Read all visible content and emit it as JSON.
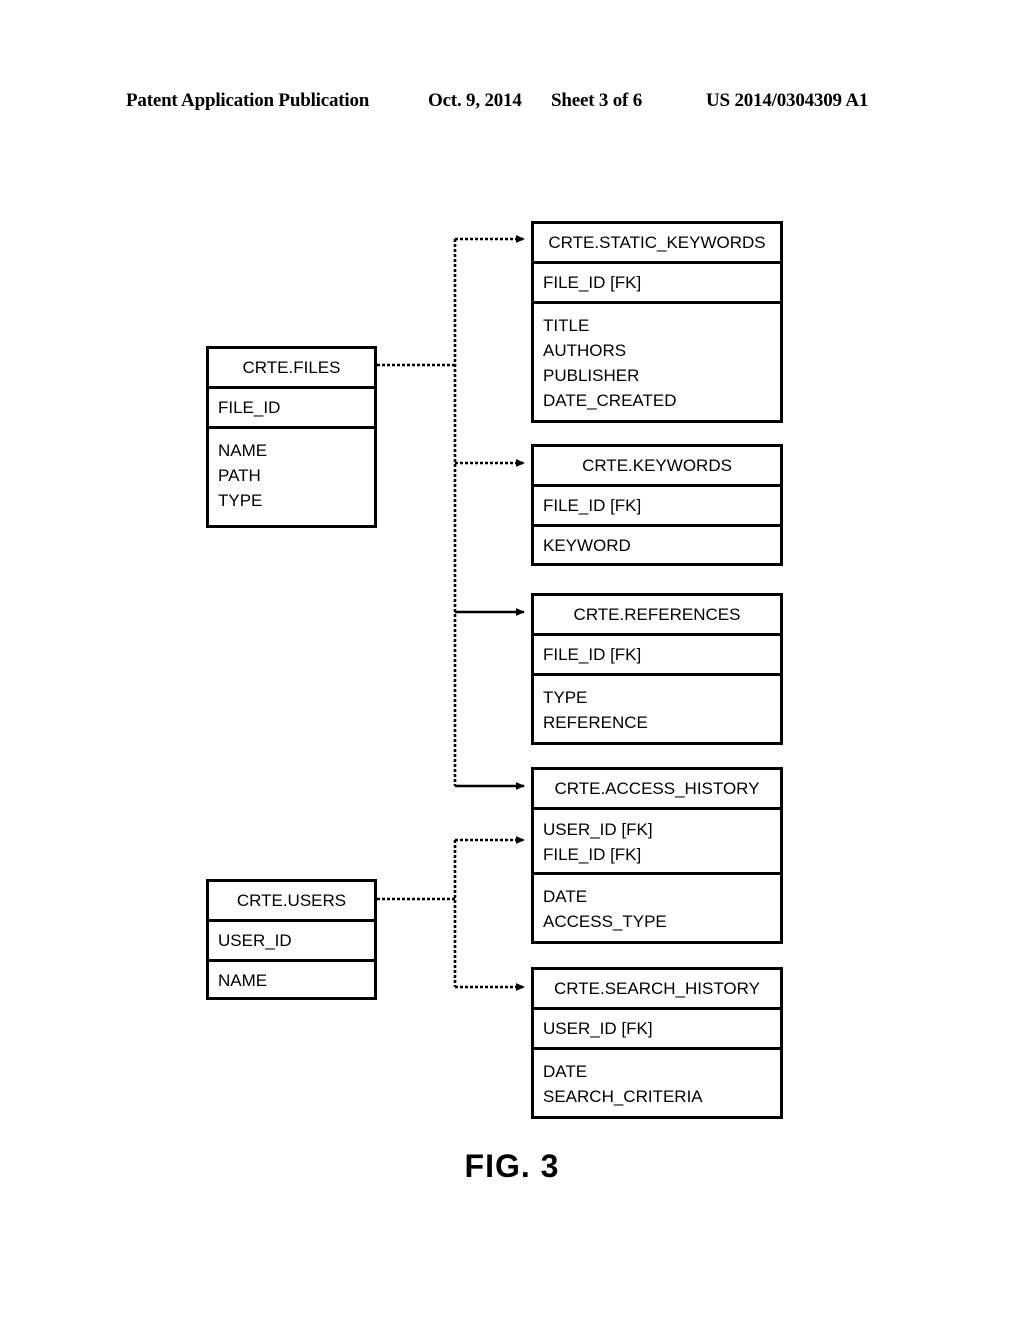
{
  "header": {
    "publication": "Patent Application Publication",
    "date": "Oct. 9, 2014",
    "sheet": "Sheet 3 of 6",
    "publication_number": "US 2014/0304309 A1"
  },
  "figure": {
    "caption": "FIG. 3"
  },
  "diagram": {
    "type": "entity-relationship-diagram",
    "entities": [
      {
        "id": "crte-files",
        "title": "CRTE.FILES",
        "keys": [
          "FILE_ID"
        ],
        "attributes": [
          "NAME",
          "PATH",
          "TYPE"
        ]
      },
      {
        "id": "crte-users",
        "title": "CRTE.USERS",
        "keys": [
          "USER_ID"
        ],
        "attributes": [
          "NAME"
        ]
      },
      {
        "id": "crte-static-keywords",
        "title": "CRTE.STATIC_KEYWORDS",
        "keys": [
          "FILE_ID [FK]"
        ],
        "attributes": [
          "TITLE",
          "AUTHORS",
          "PUBLISHER",
          "DATE_CREATED"
        ]
      },
      {
        "id": "crte-keywords",
        "title": "CRTE.KEYWORDS",
        "keys": [
          "FILE_ID [FK]"
        ],
        "attributes": [
          "KEYWORD"
        ]
      },
      {
        "id": "crte-references",
        "title": "CRTE.REFERENCES",
        "keys": [
          "FILE_ID [FK]"
        ],
        "attributes": [
          "TYPE",
          "REFERENCE"
        ]
      },
      {
        "id": "crte-access-history",
        "title": "CRTE.ACCESS_HISTORY",
        "keys": [
          "USER_ID [FK]",
          "FILE_ID [FK]"
        ],
        "attributes": [
          "DATE",
          "ACCESS_TYPE"
        ]
      },
      {
        "id": "crte-search-history",
        "title": "CRTE.SEARCH_HISTORY",
        "keys": [
          "USER_ID [FK]"
        ],
        "attributes": [
          "DATE",
          "SEARCH_CRITERIA"
        ]
      }
    ],
    "relationships": [
      {
        "from": "crte-files",
        "to": "crte-static-keywords",
        "style": "dashed-arrow"
      },
      {
        "from": "crte-files",
        "to": "crte-keywords",
        "style": "dashed-arrow"
      },
      {
        "from": "crte-files",
        "to": "crte-references",
        "style": "solid-arrow"
      },
      {
        "from": "crte-files",
        "to": "crte-access-history",
        "style": "solid-arrow"
      },
      {
        "from": "crte-users",
        "to": "crte-access-history",
        "style": "dashed-arrow"
      },
      {
        "from": "crte-users",
        "to": "crte-search-history",
        "style": "dashed-arrow"
      }
    ],
    "colors": {
      "line": "#000000",
      "box_fill": "#ffffff",
      "text": "#000000"
    }
  }
}
